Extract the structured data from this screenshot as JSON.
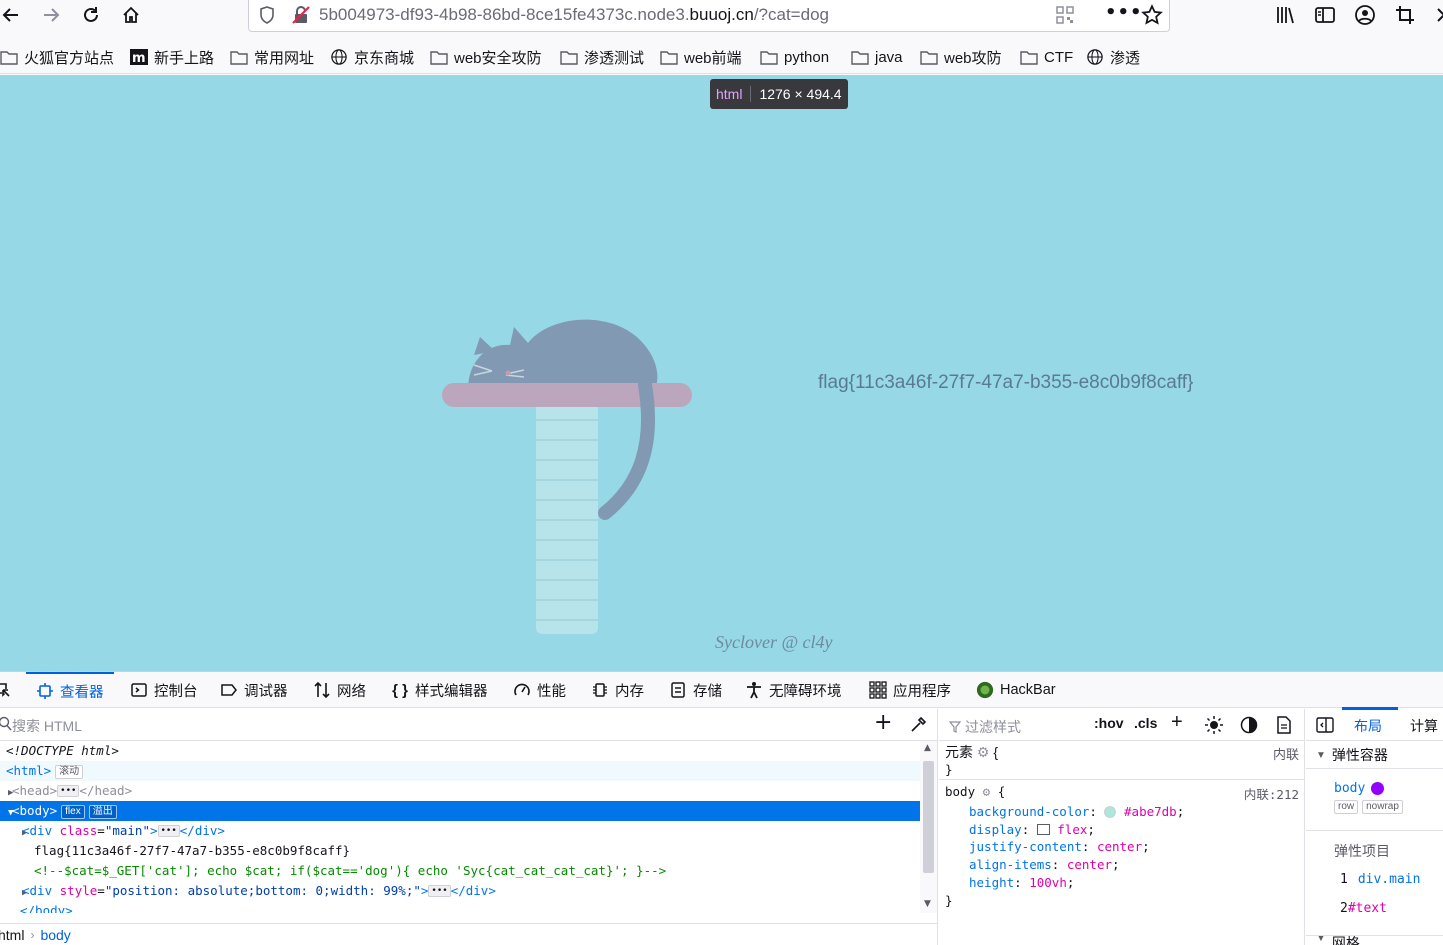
{
  "browser": {
    "url_prefix": "5b004973-df93-4b98-86bd-8ce15fe4373c.node3.",
    "url_domain": "buuoj.cn",
    "url_suffix": "/?cat=dog"
  },
  "bookmarks": [
    {
      "label": "火狐官方站点",
      "icon": "folder-icon"
    },
    {
      "label": "新手上路",
      "icon": "m-logo-icon"
    },
    {
      "label": "常用网址",
      "icon": "folder-icon"
    },
    {
      "label": "京东商城",
      "icon": "globe-icon"
    },
    {
      "label": "web安全攻防",
      "icon": "folder-icon"
    },
    {
      "label": "渗透测试",
      "icon": "folder-icon"
    },
    {
      "label": "web前端",
      "icon": "folder-icon"
    },
    {
      "label": "python",
      "icon": "folder-icon"
    },
    {
      "label": "java",
      "icon": "folder-icon"
    },
    {
      "label": "web攻防",
      "icon": "folder-icon"
    },
    {
      "label": "CTF",
      "icon": "folder-icon"
    },
    {
      "label": "渗透",
      "icon": "globe-icon"
    }
  ],
  "page": {
    "background": "#96d8e5",
    "tooltip_tag": "html",
    "tooltip_size": "1276 × 494.4",
    "flag": "flag{11c3a46f-27f7-47a7-b355-e8c0b9f8caff}",
    "signature": "Syclover @ cl4y"
  },
  "devtools": {
    "tabs": [
      {
        "label": "查看器",
        "icon": "inspector-icon"
      },
      {
        "label": "控制台",
        "icon": "console-icon"
      },
      {
        "label": "调试器",
        "icon": "debugger-icon"
      },
      {
        "label": "网络",
        "icon": "network-icon"
      },
      {
        "label": "样式编辑器",
        "icon": "style-editor-icon"
      },
      {
        "label": "性能",
        "icon": "performance-icon"
      },
      {
        "label": "内存",
        "icon": "memory-icon"
      },
      {
        "label": "存储",
        "icon": "storage-icon"
      },
      {
        "label": "无障碍环境",
        "icon": "accessibility-icon"
      },
      {
        "label": "应用程序",
        "icon": "application-icon"
      },
      {
        "label": "HackBar",
        "icon": "hackbar-icon"
      }
    ],
    "search_placeholder": "搜索 HTML",
    "markup": {
      "doctype": "<!DOCTYPE html>",
      "html_tag": "<html>",
      "html_badge": "滚动",
      "head_open": "<head>",
      "head_close": "</head>",
      "body_tag": "<body>",
      "body_badge_flex": "flex",
      "body_badge_overflow": "溢出",
      "div_main_open": "<div",
      "div_main_attr": "class",
      "div_main_val": "\"main\"",
      "div_close": "</div>",
      "flag_text": "flag{11c3a46f-27f7-47a7-b355-e8c0b9f8caff}",
      "comment": "<!--$cat=$_GET['cat']; echo $cat; if($cat=='dog'){ echo 'Syc{cat_cat_cat_cat}'; }-->",
      "div2_attr": "style",
      "div2_val": "\"position: absolute;bottom: 0;width: 99%;\"",
      "body_close": "</body>"
    },
    "breadcrumb": [
      "html",
      "body"
    ],
    "rules": {
      "filter_placeholder": "过滤样式",
      "hov": ":hov",
      "cls": ".cls",
      "element_selector": "元素",
      "element_source": "内联",
      "body_selector": "body",
      "body_source": "内联:212",
      "declarations": [
        {
          "prop": "background-color",
          "value": "#abe7db",
          "swatch": "#abe7db"
        },
        {
          "prop": "display",
          "value": "flex"
        },
        {
          "prop": "justify-content",
          "value": "center"
        },
        {
          "prop": "align-items",
          "value": "center"
        },
        {
          "prop": "height",
          "value": "100vh"
        }
      ]
    },
    "layout": {
      "tab_layout": "布局",
      "tab_computed": "计算",
      "flex_container_title": "弹性容器",
      "container_name": "body",
      "badge_row": "row",
      "badge_nowrap": "nowrap",
      "flex_items_title": "弹性项目",
      "items": [
        {
          "index": "1",
          "name": "div.main"
        },
        {
          "index": "2",
          "name": "#text"
        }
      ],
      "grid_title": "网格"
    }
  }
}
